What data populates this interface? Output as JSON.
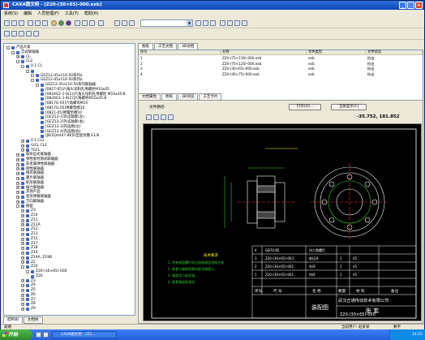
{
  "window": {
    "title": "CAXA图文档 - [Z20-(30×65)-000.exb]",
    "minimize": "_",
    "maximize": "□",
    "close": "×"
  },
  "menu": [
    "系统(S)",
    "编辑",
    "人员管理(F)",
    "工具(T)",
    "帮助(H)"
  ],
  "toolbar": {
    "zoom_combo": ""
  },
  "tree": {
    "items": [
      {
        "label": "产品大类",
        "depth": 0,
        "expander": "-"
      },
      {
        "label": "芯式联轴器",
        "depth": 1,
        "expander": "-"
      },
      {
        "label": "CL",
        "depth": 2,
        "expander": "+"
      },
      {
        "label": "CL2",
        "depth": 2,
        "expander": "-"
      },
      {
        "label": "0.1 CL",
        "depth": 3,
        "expander": "-"
      },
      {
        "label": "",
        "depth": 4,
        "expander": "-"
      },
      {
        "label": "GEZ12-45x110-50系列a",
        "depth": 5,
        "expander": "-"
      },
      {
        "label": "GEZ12-45x110-50系列a",
        "depth": 5,
        "expander": "-"
      },
      {
        "label": "GEZ12-45x110-50系列联轴器",
        "depth": 6,
        "expander": "-"
      },
      {
        "label": "[0827-05]六角头铰制孔用螺栓M10x45",
        "depth": 7,
        "expander": ""
      },
      {
        "label": "[0834G2-1-8(2)]六角头铰制孔用螺栓 M10x45-B",
        "depth": 7,
        "expander": ""
      },
      {
        "label": "[0834G1-1-8(2)]六角螺栓M10x45-B",
        "depth": 7,
        "expander": ""
      },
      {
        "label": "[0817G-05]六角螺母M10",
        "depth": 7,
        "expander": ""
      },
      {
        "label": "[0817G-05]弹簧垫圈10",
        "depth": 7,
        "expander": ""
      },
      {
        "label": "[0821-05]弹簧垫圈10",
        "depth": 7,
        "expander": ""
      },
      {
        "label": "[GEZ12-1]外齿轴套(左)",
        "depth": 7,
        "expander": ""
      },
      {
        "label": "[GEZ12-2]外齿轴套(右)",
        "depth": 7,
        "expander": ""
      },
      {
        "label": "[GEZ12-3]内齿圈(左)",
        "depth": 7,
        "expander": ""
      },
      {
        "label": "[GEZ12-4]内齿圈(右)",
        "depth": 7,
        "expander": ""
      },
      {
        "label": "[JB/ZQ4447-86]O型密封圈 E1/8",
        "depth": 7,
        "expander": ""
      },
      {
        "label": "0.1 CL2",
        "depth": 3,
        "expander": "+"
      },
      {
        "label": "GICL CL2",
        "depth": 3,
        "expander": "+"
      },
      {
        "label": "TGCL",
        "depth": 3,
        "expander": "+"
      },
      {
        "label": "鼓形齿式联轴器",
        "depth": 2,
        "expander": "+"
      },
      {
        "label": "弹性套柱销式联轴器",
        "depth": 2,
        "expander": "+"
      },
      {
        "label": "非金属弹性联轴器",
        "depth": 2,
        "expander": "+"
      },
      {
        "label": "刚性联轴器",
        "depth": 2,
        "expander": "+"
      },
      {
        "label": "梅花联轴器",
        "depth": 2,
        "expander": "+"
      },
      {
        "label": "膜片联轴器",
        "depth": 2,
        "expander": "+"
      },
      {
        "label": "蛇形联轴器",
        "depth": 2,
        "expander": "+"
      },
      {
        "label": "磁力联轴器",
        "depth": 2,
        "expander": "+"
      },
      {
        "label": "其他产品",
        "depth": 2,
        "expander": "+"
      },
      {
        "label": "星形弹簧联轴器",
        "depth": 2,
        "expander": "+"
      },
      {
        "label": "万向联轴器",
        "depth": 2,
        "expander": "+"
      },
      {
        "label": "胀套",
        "depth": 2,
        "expander": "-"
      },
      {
        "label": "Z3",
        "depth": 3,
        "expander": "+"
      },
      {
        "label": "Z10",
        "depth": 3,
        "expander": "+"
      },
      {
        "label": "Z11",
        "depth": 3,
        "expander": "+"
      },
      {
        "label": "Z11A",
        "depth": 3,
        "expander": "+"
      },
      {
        "label": "Z12",
        "depth": 3,
        "expander": "+"
      },
      {
        "label": "Z13",
        "depth": 3,
        "expander": "+"
      },
      {
        "label": "Z15",
        "depth": 3,
        "expander": "+"
      },
      {
        "label": "Z17",
        "depth": 3,
        "expander": "+"
      },
      {
        "label": "Z18",
        "depth": 3,
        "expander": "+"
      },
      {
        "label": "Z19",
        "depth": 3,
        "expander": "+"
      },
      {
        "label": "Z19A, Z19B",
        "depth": 3,
        "expander": "+"
      },
      {
        "label": "Z2",
        "depth": 3,
        "expander": "+"
      },
      {
        "label": "Z20",
        "depth": 3,
        "expander": "-"
      },
      {
        "label": "Z20-(30×65)-000",
        "depth": 4,
        "expander": "-"
      },
      {
        "label": "Z20",
        "depth": 5,
        "expander": ""
      },
      {
        "label": "Z3",
        "depth": 3,
        "expander": "+"
      },
      {
        "label": "Z4",
        "depth": 3,
        "expander": "+"
      },
      {
        "label": "Z5",
        "depth": 3,
        "expander": "+"
      },
      {
        "label": "Z6",
        "depth": 3,
        "expander": "+"
      },
      {
        "label": "Z7",
        "depth": 3,
        "expander": "+"
      },
      {
        "label": "Z8",
        "depth": 3,
        "expander": "+"
      },
      {
        "label": "Z9",
        "depth": 3,
        "expander": "+"
      }
    ],
    "tabs": [
      "结构树",
      "文档树"
    ]
  },
  "top_tabs": [
    "图纸",
    "工艺文档",
    "3D文档"
  ],
  "file_table": {
    "headers": [
      "序号",
      "名称",
      "文件类型",
      "文件状态"
    ],
    "rows": [
      [
        "1",
        "Z20-(75×130)-000.exb",
        "exb",
        "检出"
      ],
      [
        "2",
        "Z20-(70×120)-000.exb",
        "exb",
        "检出"
      ],
      [
        "3",
        "Z20-(30×65)-000.exb",
        "exb",
        "检出"
      ],
      [
        "4",
        "Z20-(40×75)-000.exb",
        "exb",
        "检出"
      ]
    ]
  },
  "viewer": {
    "tabs": [
      "文档属性",
      "图纸",
      "3D浏览",
      "工艺卡片"
    ],
    "file_path_label": "文件路径:",
    "open_button": "打开(O)...",
    "fullscreen_button": "全屏显示(F)",
    "coords": "-35.752, 181.852"
  },
  "drawing": {
    "tech_req_title": "技术要求",
    "tech_req": [
      "1. 所有紧固螺钉须分别按规定扭矩拧紧.",
      "2. 胀套与轴和轮毂的配合按图示.",
      "3. 锥面涂二硫化钼.",
      "4. 胀套装配前清洗."
    ],
    "title_cols": [
      "序号",
      "代 号",
      "名 称",
      "数量",
      "材 料",
      "备注"
    ],
    "company": "武汉正通传动技术有限公司",
    "drawing_name": "装配图",
    "part_name": "胀 套",
    "part_code": "Z20-(30×65)-000",
    "bom": [
      [
        "4",
        "GB70-85",
        "内六角螺钉",
        "",
        "",
        ""
      ],
      [
        "3",
        "Z20-(30×65)-003",
        "前压环",
        "1",
        "45",
        ""
      ],
      [
        "2",
        "Z20-(30×65)-002",
        "外环",
        "1",
        "45",
        ""
      ],
      [
        "1",
        "Z20-(30×65)-001",
        "内环",
        "1",
        "45",
        ""
      ]
    ]
  },
  "statusbar": {
    "user": "当前用户: 赵某某",
    "ready": "就绪",
    "mode": "数字"
  },
  "taskbar": {
    "start": "开始",
    "task": "CAXA图文档 - [Z2...",
    "time": "14:25"
  }
}
